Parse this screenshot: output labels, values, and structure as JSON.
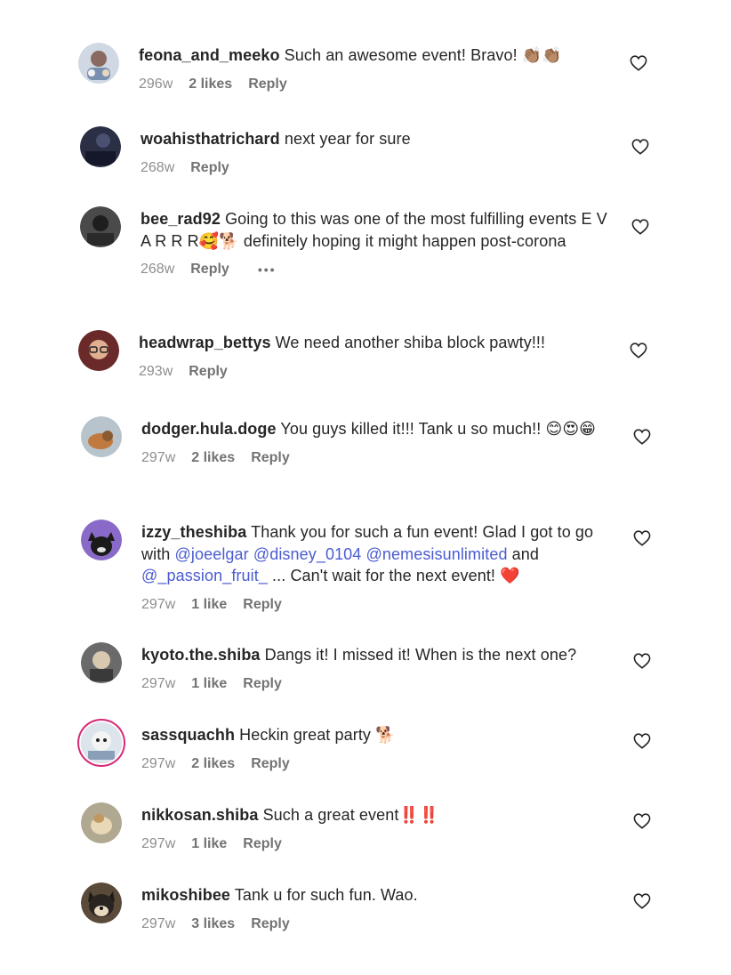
{
  "comments": [
    {
      "username": "feona_and_meeko",
      "text": "Such an awesome event! Bravo! 👏🏽👏🏽",
      "time": "296w",
      "likes": "2 likes",
      "reply": "Reply",
      "avatar_color": "#a8b8c8"
    },
    {
      "username": "woahisthatrichard",
      "text": "next year for sure",
      "time": "268w",
      "likes": "",
      "reply": "Reply",
      "avatar_color": "#2a2f45"
    },
    {
      "username": "bee_rad92",
      "text": "Going to this was one of the most fulfilling events E V A R R R🥰🐕 definitely hoping it might happen post-corona",
      "time": "268w",
      "likes": "",
      "reply": "Reply",
      "more": "•••",
      "avatar_color": "#3a3a3a"
    },
    {
      "username": "headwrap_bettys",
      "text": "We need another shiba block pawty!!!",
      "time": "293w",
      "likes": "",
      "reply": "Reply",
      "avatar_color": "#7a3a3a"
    },
    {
      "username": "dodger.hula.doge",
      "text": "You guys killed it!!! Tank u so much!! 😊😍😁",
      "time": "297w",
      "likes": "2 likes",
      "reply": "Reply",
      "avatar_color": "#8a6a50"
    },
    {
      "username": "izzy_theshiba",
      "text_before": "Thank you for such a fun event! Glad I got to go with ",
      "m1": "@joeelgar",
      "m2": "@disney_0104",
      "m3": "@nemesisunlimited",
      "and_word": " and ",
      "m4": "@_passion_fruit_",
      "text_after": " ... Can't wait for the next event! ❤️",
      "time": "297w",
      "likes": "1 like",
      "reply": "Reply",
      "avatar_color": "#6a4aa0"
    },
    {
      "username": "kyoto.the.shiba",
      "text": "Dangs it! I missed it! When is the next one?",
      "time": "297w",
      "likes": "1 like",
      "reply": "Reply",
      "avatar_color": "#5a5a5a"
    },
    {
      "username": "sassquachh",
      "text": "Heckin great party 🐕",
      "time": "297w",
      "likes": "2 likes",
      "reply": "Reply",
      "avatar_color": "#c8d4e0"
    },
    {
      "username": "nikkosan.shiba",
      "text": "Such a great event‼️‼️",
      "time": "297w",
      "likes": "1 like",
      "reply": "Reply",
      "avatar_color": "#9a8a70"
    },
    {
      "username": "mikoshibee",
      "text": "Tank u for such fun. Wao.",
      "time": "297w",
      "likes": "3 likes",
      "reply": "Reply",
      "avatar_color": "#3a3028"
    }
  ],
  "heart_color": "#262626",
  "mention_color": "#4a5cd1"
}
